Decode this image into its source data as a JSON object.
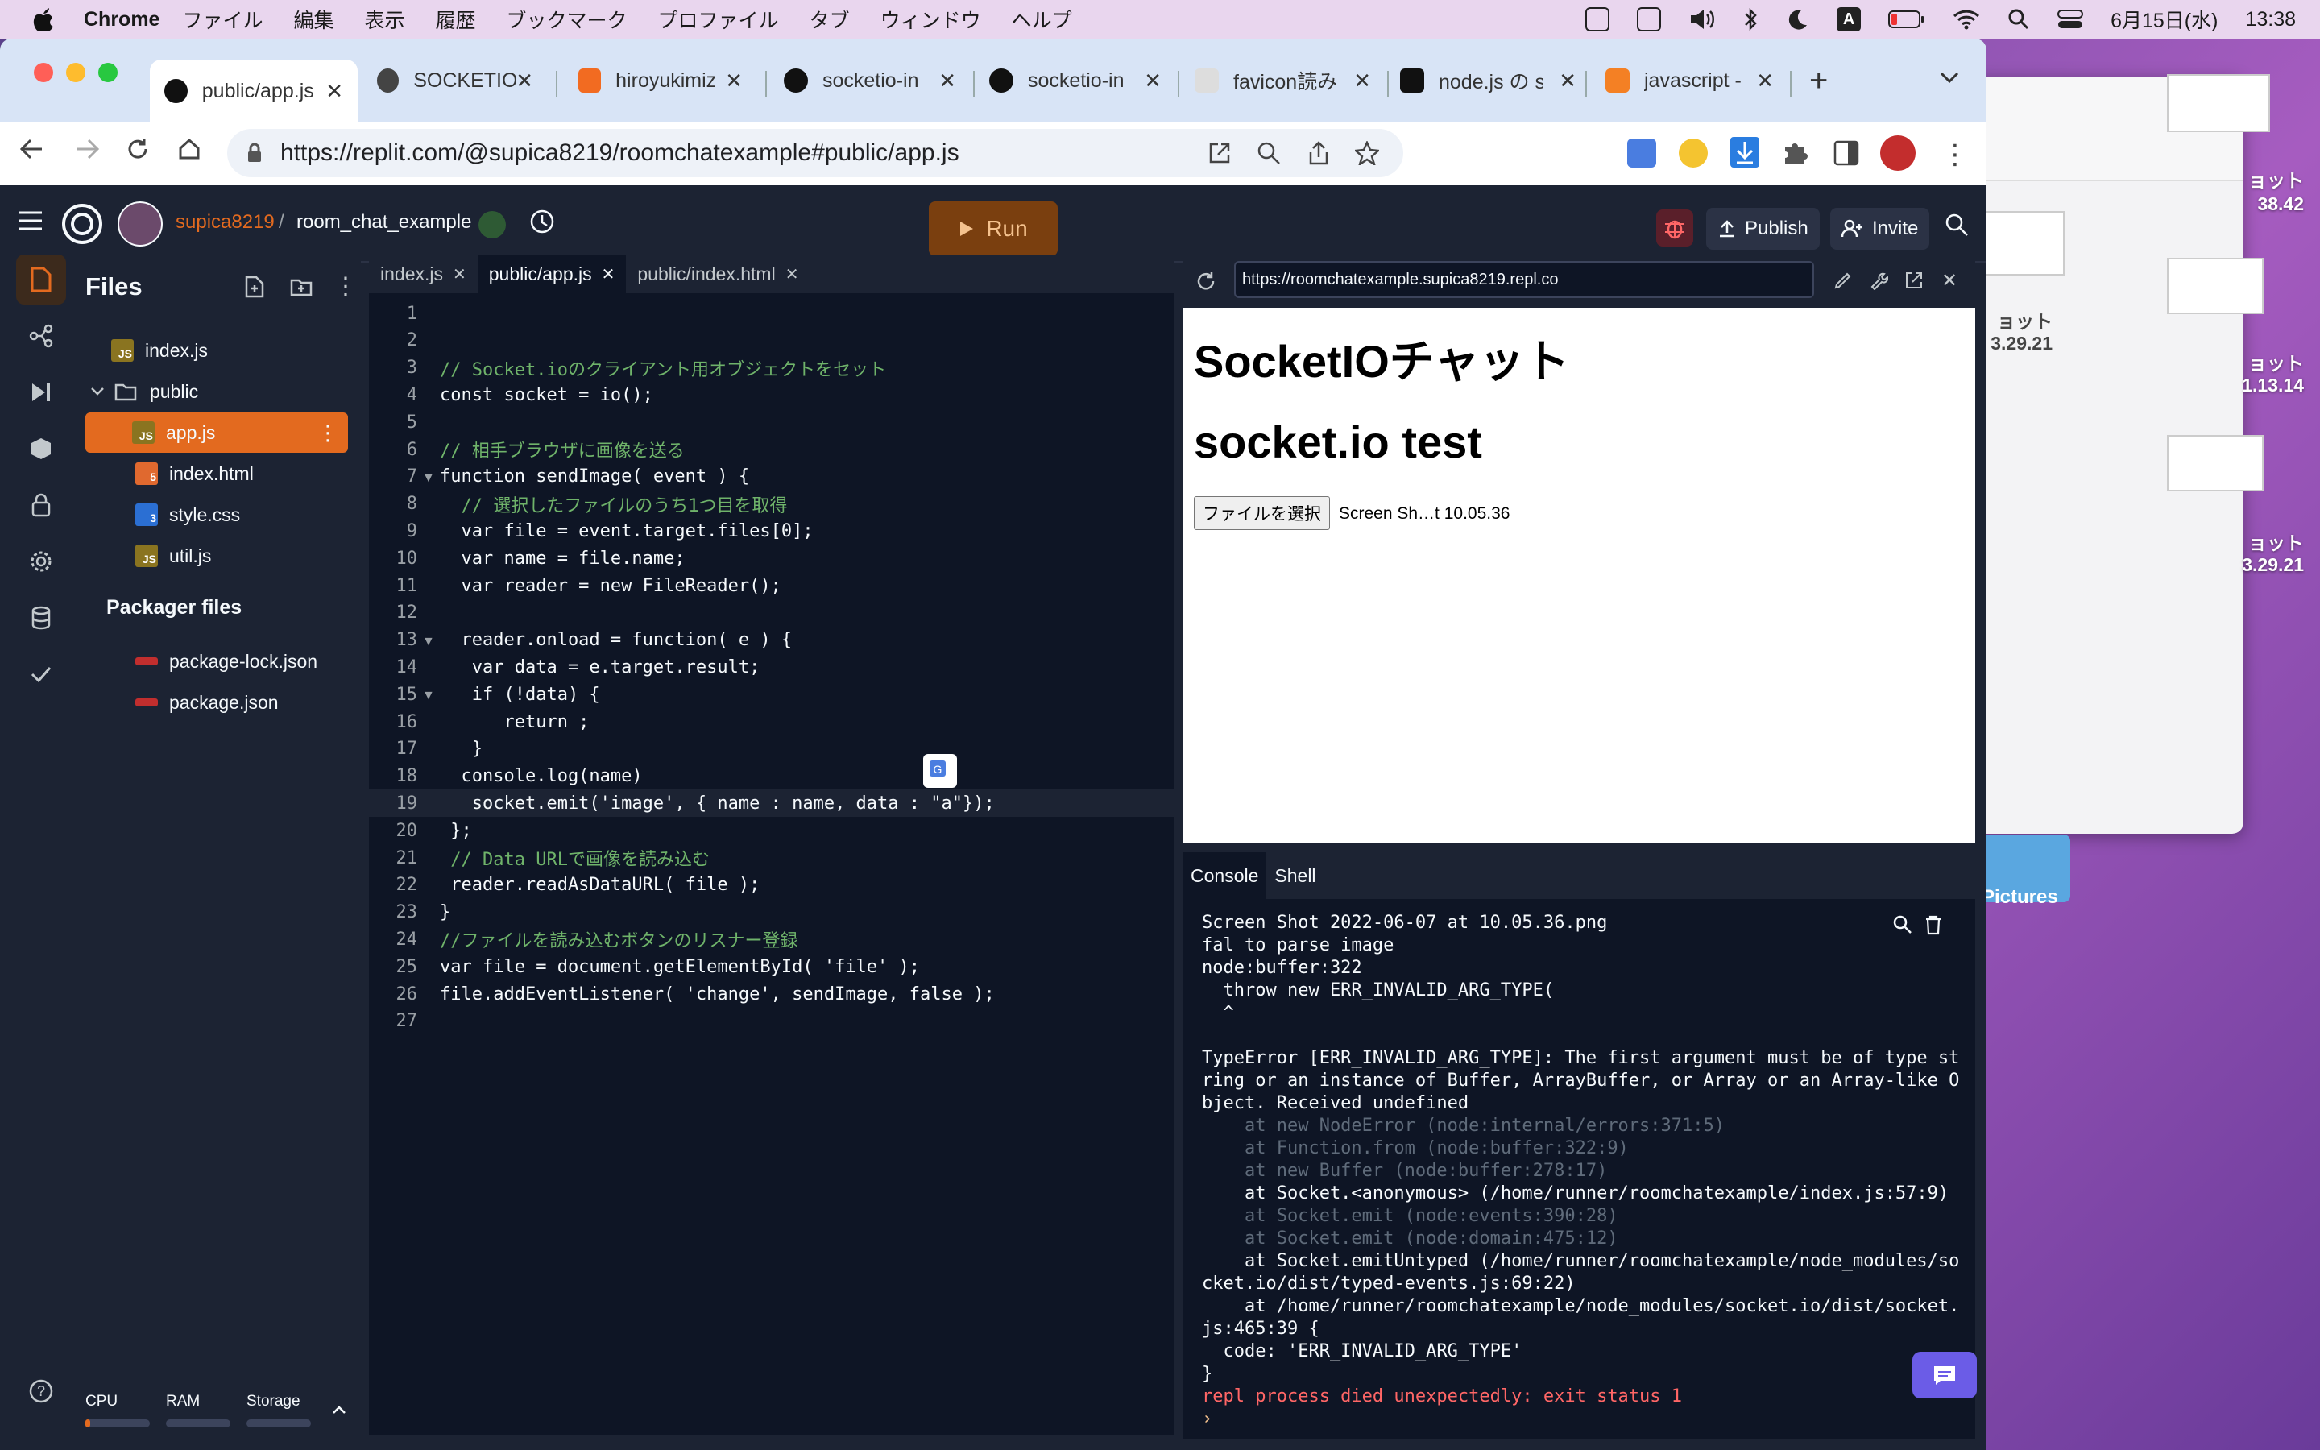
{
  "menubar": {
    "app": "Chrome",
    "items": [
      "ファイル",
      "編集",
      "表示",
      "履歴",
      "ブックマーク",
      "プロファイル",
      "タブ",
      "ウィンドウ",
      "ヘルプ"
    ],
    "date": "6月15日(水)",
    "time": "13:38",
    "input_mode": "A"
  },
  "desktop": {
    "labels": [
      "ョット",
      "38.42",
      "ョット",
      "3.29.21",
      "ョット",
      "1.13.14",
      "ョット",
      "3.29.21"
    ],
    "pictures": "Pictures"
  },
  "browser": {
    "tabs": [
      {
        "title": "public/app.js",
        "active": true
      },
      {
        "title": "SOCKETIO"
      },
      {
        "title": "hiroyukimiz"
      },
      {
        "title": "socketio-in"
      },
      {
        "title": "socketio-in"
      },
      {
        "title": "favicon読み"
      },
      {
        "title": "node.js の s"
      },
      {
        "title": "javascript -"
      }
    ],
    "url": "https://replit.com/@supica8219/roomchatexample#public/app.js"
  },
  "replit": {
    "user": "supica8219",
    "project": "room_chat_example",
    "run_label": "Run",
    "publish_label": "Publish",
    "invite_label": "Invite",
    "files_title": "Files",
    "files": [
      {
        "name": "index.js",
        "type": "js"
      },
      {
        "name": "public",
        "type": "folder"
      },
      {
        "name": "app.js",
        "type": "js",
        "selected": true
      },
      {
        "name": "index.html",
        "type": "html"
      },
      {
        "name": "style.css",
        "type": "css"
      },
      {
        "name": "util.js",
        "type": "js"
      }
    ],
    "packager_title": "Packager files",
    "packager_files": [
      "package-lock.json",
      "package.json"
    ],
    "resources": {
      "cpu": "CPU",
      "ram": "RAM",
      "storage": "Storage"
    },
    "editor_tabs": [
      "index.js",
      "public/app.js",
      "public/index.html"
    ],
    "code_lines": [
      "",
      "",
      "// Socket.ioのクライアント用オブジェクトをセット",
      "const socket = io();",
      "",
      "// 相手ブラウザに画像を送る",
      "function sendImage( event ) {",
      "  // 選択したファイルのうち1つ目を取得",
      "  var file = event.target.files[0];",
      "  var name = file.name;",
      "  var reader = new FileReader();",
      "",
      "  reader.onload = function( e ) {",
      "   var data = e.target.result;",
      "   if (!data) {",
      "      return ;",
      "   }",
      "  console.log(name)",
      "   socket.emit('image', { name : name, data : \"a\"});",
      " };",
      " // Data URLで画像を読み込む",
      " reader.readAsDataURL( file );",
      "}",
      "//ファイルを読み込むボタンのリスナー登録",
      "var file = document.getElementById( 'file' );",
      "file.addEventListener( 'change', sendImage, false );",
      ""
    ],
    "preview": {
      "url": "https://roomchatexample.supica8219.repl.co",
      "h1": "SocketIOチャット",
      "h2": "socket.io test",
      "file_button": "ファイルを選択",
      "file_name": "Screen Sh…t 10.05.36"
    },
    "console_tabs": [
      "Console",
      "Shell"
    ],
    "console_lines": [
      {
        "t": "Screen Shot 2022-06-07 at 10.05.36.png",
        "c": "#f5f9fc"
      },
      {
        "t": "fal to parse image",
        "c": "#f5f9fc"
      },
      {
        "t": "node:buffer:322",
        "c": "#f5f9fc"
      },
      {
        "t": "  throw new ERR_INVALID_ARG_TYPE(",
        "c": "#f5f9fc"
      },
      {
        "t": "  ^",
        "c": "#f5f9fc"
      },
      {
        "t": "",
        "c": "#f5f9fc"
      },
      {
        "t": "TypeError [ERR_INVALID_ARG_TYPE]: The first argument must be of type st",
        "c": "#f5f9fc"
      },
      {
        "t": "ring or an instance of Buffer, ArrayBuffer, or Array or an Array-like O",
        "c": "#f5f9fc"
      },
      {
        "t": "bject. Received undefined",
        "c": "#f5f9fc"
      },
      {
        "t": "    at new NodeError (node:internal/errors:371:5)",
        "c": "#5f6b7a"
      },
      {
        "t": "    at Function.from (node:buffer:322:9)",
        "c": "#5f6b7a"
      },
      {
        "t": "    at new Buffer (node:buffer:278:17)",
        "c": "#5f6b7a"
      },
      {
        "t": "    at Socket.<anonymous> (/home/runner/roomchatexample/index.js:57:9)",
        "c": "#f5f9fc"
      },
      {
        "t": "    at Socket.emit (node:events:390:28)",
        "c": "#5f6b7a"
      },
      {
        "t": "    at Socket.emit (node:domain:475:12)",
        "c": "#5f6b7a"
      },
      {
        "t": "    at Socket.emitUntyped (/home/runner/roomchatexample/node_modules/so",
        "c": "#f5f9fc"
      },
      {
        "t": "cket.io/dist/typed-events.js:69:22)",
        "c": "#f5f9fc"
      },
      {
        "t": "    at /home/runner/roomchatexample/node_modules/socket.io/dist/socket.",
        "c": "#f5f9fc"
      },
      {
        "t": "js:465:39 {",
        "c": "#f5f9fc"
      },
      {
        "t": "  code: 'ERR_INVALID_ARG_TYPE'",
        "c": "#f5f9fc"
      },
      {
        "t": "}",
        "c": "#f5f9fc"
      },
      {
        "t": "repl process died unexpectedly: exit status 1",
        "c": "#ff6666"
      },
      {
        "t": "› ",
        "c": "#f5c28e"
      }
    ],
    "colors": {
      "accent": "#e36a1f",
      "run_bg": "#7a3f0f",
      "bg": "#1c2333",
      "editor_bg": "#0e1525"
    }
  }
}
